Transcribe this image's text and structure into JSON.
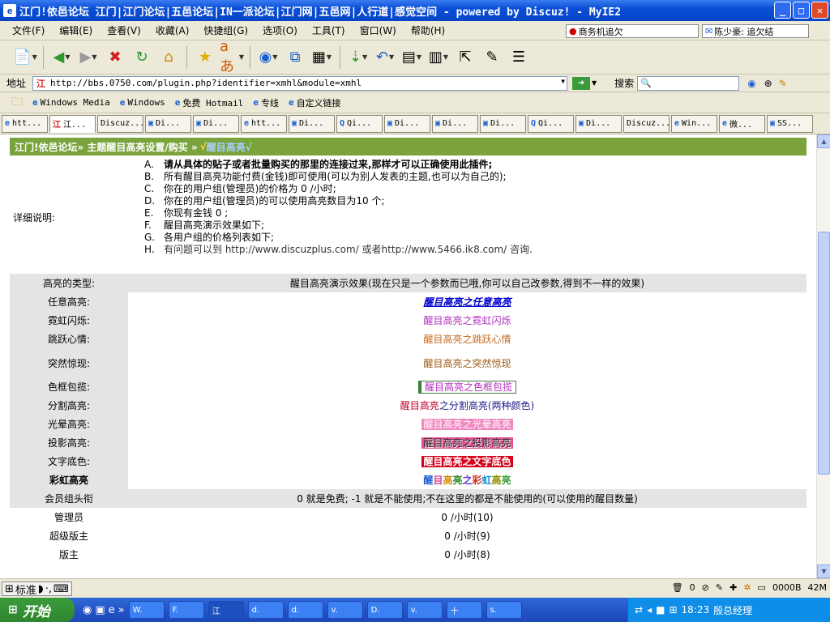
{
  "window": {
    "title": "江门!依邑论坛 江门|江门论坛|五邑论坛|IN一派论坛|江门网|五邑网|人行道|感觉空间 - powered by Discuz! - MyIE2",
    "title_icon": "ie-icon"
  },
  "menu": {
    "items": [
      "文件(F)",
      "编辑(E)",
      "查看(V)",
      "收藏(A)",
      "快捷组(G)",
      "选项(O)",
      "工具(T)",
      "窗口(W)",
      "帮助(H)"
    ],
    "news1": "商务机追欠",
    "news2": "陈少豪: 追欠结"
  },
  "address": {
    "label": "地址",
    "url": "http://bbs.0750.com/plugin.php?identifier=xmhl&module=xmhl",
    "search_label": "搜索"
  },
  "links": {
    "items": [
      "Windows Media",
      "Windows",
      "免费 Hotmail",
      "专线",
      "自定义链接"
    ]
  },
  "tabs": [
    "htt...",
    "江...",
    "Discuz...",
    "Di...",
    "Di...",
    "htt...",
    "Di...",
    "Qi...",
    "Di...",
    "Di...",
    "Di...",
    "Qi...",
    "Di...",
    "Discuz...",
    "Win...",
    "微...",
    "SS..."
  ],
  "page": {
    "breadcrumb": "江门!依邑论坛» 主题醒目高亮设置/购买 »",
    "breadcrumb_mark": "√",
    "breadcrumb_colored": "醒目高亮√",
    "desc_label": "详细说明:",
    "desc": [
      {
        "l": "A.",
        "t": "请从具体的贴子或者批量购买的那里的连接过来,那样才可以正确使用此插件;"
      },
      {
        "l": "B.",
        "t": "所有醒目高亮功能付费(金钱)即可使用(可以为别人发表的主题,也可以为自己的);"
      },
      {
        "l": "C.",
        "t": "你在的用户组(管理员)的价格为 0 /小时;"
      },
      {
        "l": "D.",
        "t": "你在的用户组(管理员)的可以使用高亮数目为10 个;"
      },
      {
        "l": "E.",
        "t": "你现有金钱 0 ;"
      },
      {
        "l": "F.",
        "t": "醒目高亮演示效果如下;"
      },
      {
        "l": "G.",
        "t": "各用户组的价格列表如下;"
      },
      {
        "l": "H.",
        "t": "有问题可以到 http://www.discuzplus.com/ 或者http://www.5466.ik8.com/ 咨询."
      }
    ],
    "demo_header_left": "高亮的类型:",
    "demo_header_right": "醒目高亮演示效果(现在只是一个参数而已哦,你可以自己改参数,得到不一样的效果)",
    "demos": [
      {
        "type": "任意高亮:",
        "sample": "醒目高亮之任意高亮"
      },
      {
        "type": "霓虹闪烁:",
        "sample": "醒目高亮之霓虹闪烁"
      },
      {
        "type": "跳跃心情:",
        "sample": "醒目高亮之跳跃心情"
      },
      {
        "type": "突然惊现:",
        "sample": "醒目高亮之突然惊现"
      },
      {
        "type": "色框包揽:",
        "sample": "醒目高亮之色框包揽"
      },
      {
        "type": "分割高亮:",
        "sample_a": "醒目高亮",
        "sample_b": "之分割高亮(两种颜色)"
      },
      {
        "type": "光晕高亮:",
        "sample": "醒目高亮之光晕高亮"
      },
      {
        "type": "投影高亮:",
        "sample": "醒目高亮之投影高亮"
      },
      {
        "type": "文字底色:",
        "sample": "醒目高亮之文字底色"
      },
      {
        "type": "彩虹高亮",
        "sample": "醒目高亮之彩虹高亮"
      }
    ],
    "rainbow_chars": [
      {
        "c": "醒",
        "color": "#1a5fd0"
      },
      {
        "c": "目",
        "color": "#d04a9a"
      },
      {
        "c": "高",
        "color": "#d08a00"
      },
      {
        "c": "亮",
        "color": "#2a8a2a"
      },
      {
        "c": "之",
        "color": "#6a3ad0"
      },
      {
        "c": "彩",
        "color": "#d0301a"
      },
      {
        "c": "虹",
        "color": "#1a8ad0"
      },
      {
        "c": "高",
        "color": "#8a8a00"
      },
      {
        "c": "亮",
        "color": "#3aa03a"
      }
    ],
    "group_header_left": "会员组头衔",
    "group_header_right": "0 就是免费; -1 就是不能使用;不在这里的都是不能使用的(可以使用的醒目数量)",
    "groups": [
      {
        "name": "管理员",
        "price": "0 /小时(10)"
      },
      {
        "name": "超级版主",
        "price": "0 /小时(9)"
      },
      {
        "name": "版主",
        "price": "0 /小时(8)"
      }
    ]
  },
  "status": {
    "ime": "标准",
    "count": "0",
    "size": "0000B",
    "mem": "42M"
  },
  "taskbar": {
    "start": "开始",
    "tasks": [
      "W.",
      "F.",
      "江",
      "d.",
      "d.",
      "v.",
      "D.",
      "v.",
      "十",
      "s."
    ],
    "clock": "18:23",
    "user": "殷总经理"
  },
  "colors": {
    "accent_green": "#7aa33c",
    "xp_blue": "#0845c6"
  }
}
